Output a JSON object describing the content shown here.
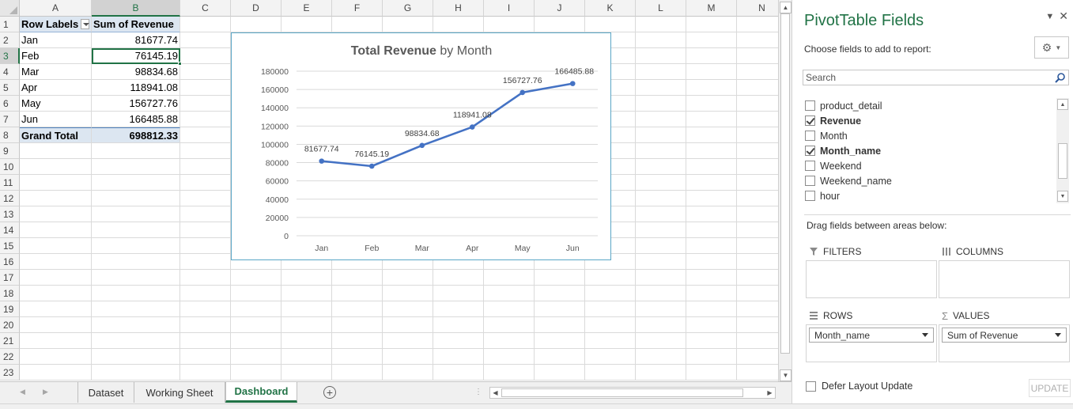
{
  "sheet": {
    "columns": [
      "A",
      "B",
      "C",
      "D",
      "E",
      "F",
      "G",
      "H",
      "I",
      "J",
      "K",
      "L",
      "M",
      "N"
    ],
    "rows": [
      "1",
      "2",
      "3",
      "4",
      "5",
      "6",
      "7",
      "8",
      "9",
      "10",
      "11",
      "12",
      "13",
      "14",
      "15",
      "16",
      "17",
      "18",
      "19",
      "20",
      "21",
      "22",
      "23"
    ],
    "pivot": {
      "header": [
        "Row Labels",
        "Sum of Revenue"
      ],
      "rows": [
        [
          "Jan",
          "81677.74"
        ],
        [
          "Feb",
          "76145.19"
        ],
        [
          "Mar",
          "98834.68"
        ],
        [
          "Apr",
          "118941.08"
        ],
        [
          "May",
          "156727.76"
        ],
        [
          "Jun",
          "166485.88"
        ]
      ],
      "total": [
        "Grand Total",
        "698812.33"
      ]
    }
  },
  "chart_data": {
    "type": "line",
    "title_bold": "Total Revenue",
    "title_rest": "by Month",
    "categories": [
      "Jan",
      "Feb",
      "Mar",
      "Apr",
      "May",
      "Jun"
    ],
    "values": [
      81677.74,
      76145.19,
      98834.68,
      118941.08,
      156727.76,
      166485.88
    ],
    "value_labels": [
      "81677.74",
      "76145.19",
      "98834.68",
      "118941.08",
      "156727.76",
      "166485.88"
    ],
    "ylim": [
      0,
      180000
    ],
    "yticks": [
      "0",
      "20000",
      "40000",
      "60000",
      "80000",
      "100000",
      "120000",
      "140000",
      "160000",
      "180000"
    ],
    "line_color": "#4472c4",
    "grid": true,
    "legend": "none"
  },
  "tabs": {
    "items": [
      "Dataset",
      "Working Sheet",
      "Dashboard"
    ],
    "active": "Dashboard"
  },
  "pane": {
    "title": "PivotTable Fields",
    "choose_label": "Choose fields to add to report:",
    "search_placeholder": "Search",
    "fields": [
      {
        "label": "product_detail",
        "checked": false
      },
      {
        "label": "Revenue",
        "checked": true
      },
      {
        "label": "Month",
        "checked": false
      },
      {
        "label": "Month_name",
        "checked": true
      },
      {
        "label": "Weekend",
        "checked": false
      },
      {
        "label": "Weekend_name",
        "checked": false
      },
      {
        "label": "hour",
        "checked": false
      }
    ],
    "drag_label": "Drag fields between areas below:",
    "filters_label": "FILTERS",
    "columns_label": "COLUMNS",
    "rows_label": "ROWS",
    "values_label": "VALUES",
    "rows_value": "Month_name",
    "values_value": "Sum of Revenue",
    "defer_label": "Defer Layout Update",
    "update_label": "UPDATE"
  },
  "colors": {
    "accent": "#217346",
    "pivot_header": "#dce6f1",
    "chart_border": "#5aa6c6"
  }
}
